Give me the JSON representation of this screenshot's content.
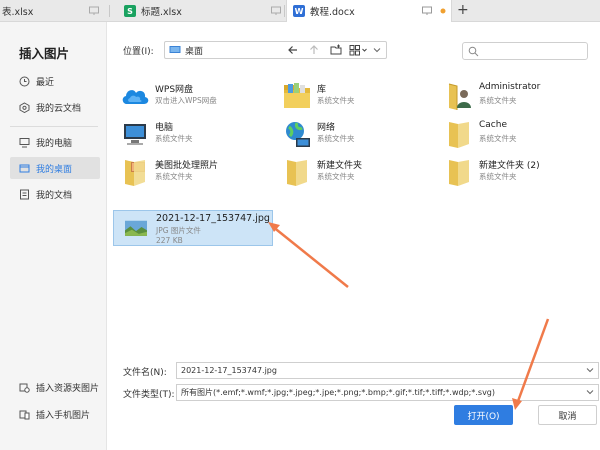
{
  "tabs": [
    {
      "label": "表.xlsx",
      "icon": "spreadsheet-icon"
    },
    {
      "label": "标题.xlsx",
      "icon": "spreadsheet-icon",
      "icon_letter": "S",
      "icon_color": "#1aa260"
    },
    {
      "label": "教程.docx",
      "icon": "document-icon",
      "icon_letter": "W",
      "icon_color": "#2f6fd6"
    }
  ],
  "new_tab_label": "+",
  "dialog": {
    "title": "插入图片",
    "sidebar": {
      "items": [
        {
          "label": "最近",
          "icon": "clock-icon"
        },
        {
          "label": "我的云文档",
          "icon": "cloud-doc-icon"
        },
        {
          "label": "我的电脑",
          "icon": "computer-icon"
        },
        {
          "label": "我的桌面",
          "icon": "desktop-icon",
          "active": true
        },
        {
          "label": "我的文档",
          "icon": "documents-icon"
        }
      ],
      "bottom_items": [
        {
          "label": "插入资源夹图片",
          "icon": "resource-folder-icon"
        },
        {
          "label": "插入手机图片",
          "icon": "phone-icon"
        }
      ]
    },
    "location": {
      "label": "位置(I):",
      "value": "桌面"
    },
    "files": [
      {
        "name": "WPS网盘",
        "type": "双击进入WPS网盘",
        "icon": "cloud-drive-icon"
      },
      {
        "name": "库",
        "type": "系统文件夹",
        "icon": "library-folder-icon"
      },
      {
        "name": "Administrator",
        "type": "系统文件夹",
        "icon": "user-folder-icon"
      },
      {
        "name": "电脑",
        "type": "系统文件夹",
        "icon": "computer-icon"
      },
      {
        "name": "网络",
        "type": "系统文件夹",
        "icon": "network-icon"
      },
      {
        "name": "Cache",
        "type": "系统文件夹",
        "icon": "folder-icon"
      },
      {
        "name": "美图批处理照片",
        "type": "系统文件夹",
        "icon": "photo-folder-icon"
      },
      {
        "name": "新建文件夹",
        "type": "系统文件夹",
        "icon": "folder-icon"
      },
      {
        "name": "新建文件夹 (2)",
        "type": "系统文件夹",
        "icon": "folder-icon"
      },
      {
        "name": "2021-12-17_153747.jpg",
        "type": "JPG 图片文件",
        "size": "227 KB",
        "icon": "image-thumbnail-icon",
        "selected": true
      }
    ],
    "filename": {
      "label": "文件名(N):",
      "value": "2021-12-17_153747.jpg"
    },
    "filetype": {
      "label": "文件类型(T):",
      "value": "所有图片(*.emf;*.wmf;*.jpg;*.jpeg;*.jpe;*.png;*.bmp;*.gif;*.tif;*.tiff;*.wdp;*.svg)"
    },
    "buttons": {
      "open": "打开(O)",
      "cancel": "取消"
    }
  },
  "colors": {
    "accent": "#2f7de1",
    "arrow": "#f07a4a",
    "selection": "#cde4f7"
  }
}
